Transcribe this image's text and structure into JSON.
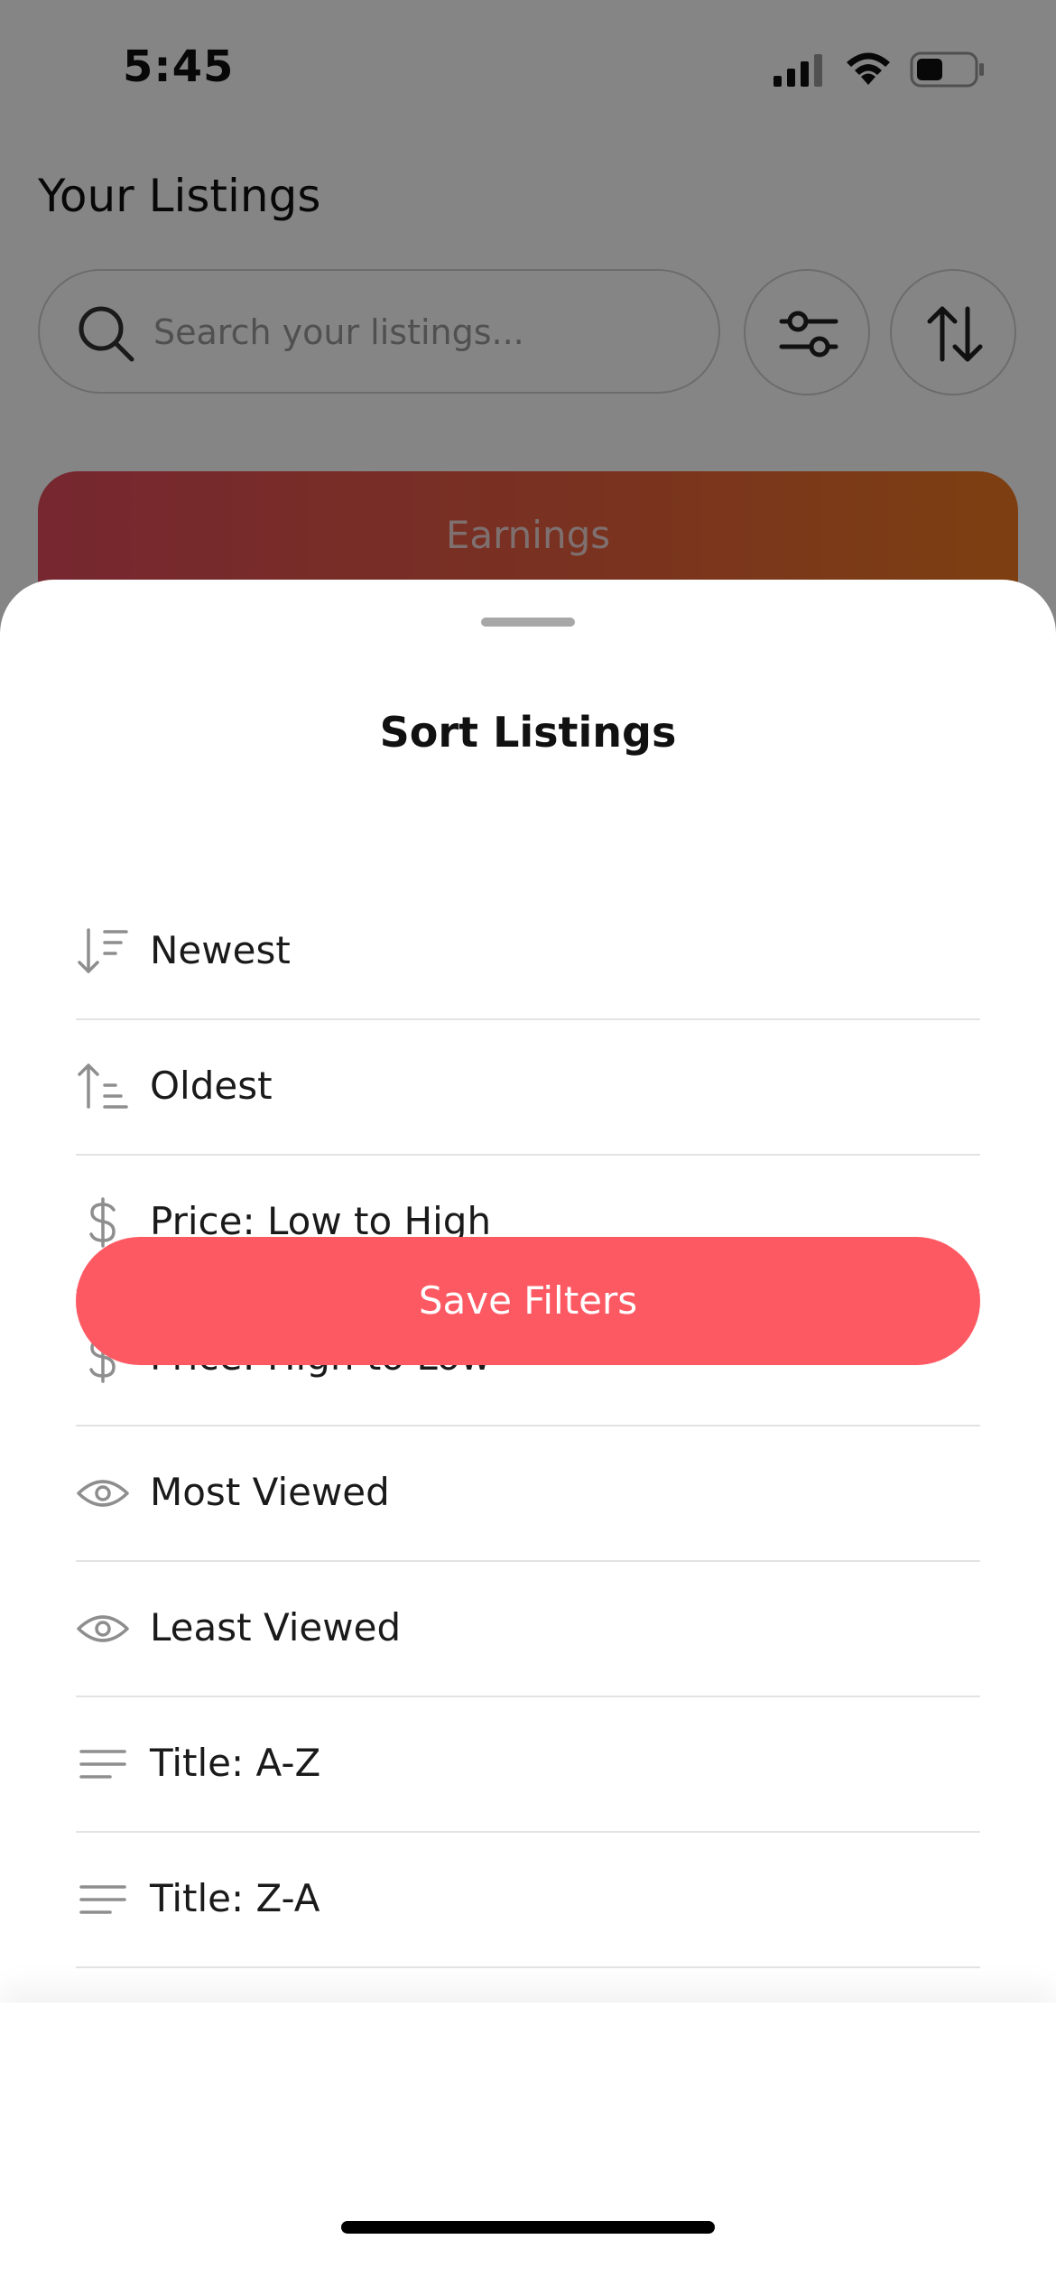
{
  "status_bar": {
    "time": "5:45"
  },
  "page": {
    "title": "Your Listings",
    "search_placeholder": "Search your listings...",
    "earnings_label": "Earnings"
  },
  "sheet": {
    "title": "Sort Listings",
    "options": [
      {
        "label": "Newest",
        "icon": "sort-descending-icon"
      },
      {
        "label": "Oldest",
        "icon": "sort-ascending-icon"
      },
      {
        "label": "Price: Low to High",
        "icon": "dollar-icon"
      },
      {
        "label": "Price: High to Low",
        "icon": "dollar-icon"
      },
      {
        "label": "Most Viewed",
        "icon": "eye-icon"
      },
      {
        "label": "Least Viewed",
        "icon": "eye-icon"
      },
      {
        "label": "Title: A-Z",
        "icon": "align-left-icon"
      },
      {
        "label": "Title: Z-A",
        "icon": "align-left-icon"
      }
    ],
    "save_button": "Save Filters"
  },
  "colors": {
    "accent": "#fd5963",
    "earnings_gradient_start": "#e34b5d",
    "earnings_gradient_end": "#f07a22",
    "icon_gray": "#8e8e8e",
    "divider": "#e3e3e3"
  }
}
